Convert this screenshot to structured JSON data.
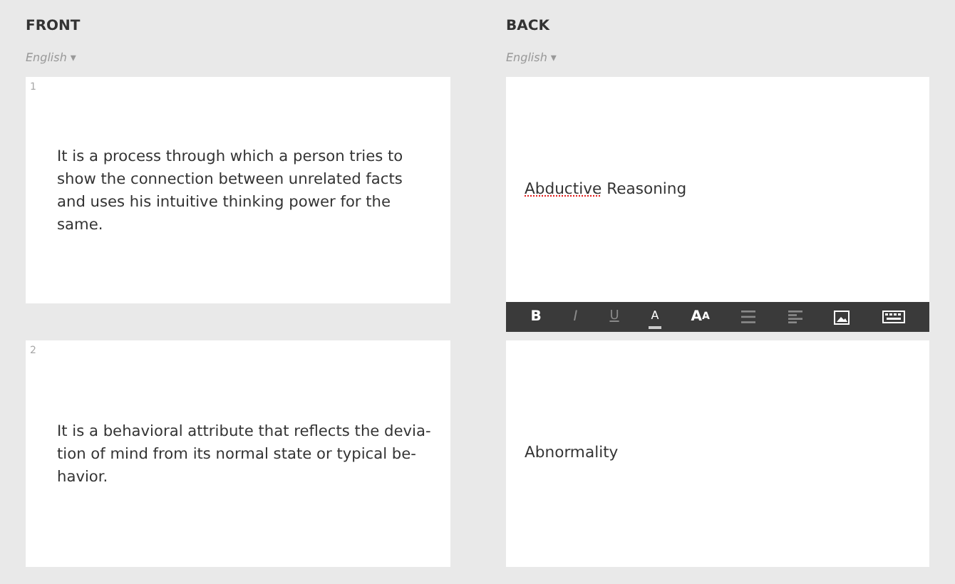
{
  "sides": [
    {
      "title": "FRONT",
      "language": "English ▾"
    },
    {
      "title": "BACK",
      "language": "English ▾"
    }
  ],
  "cards": [
    {
      "number": "1",
      "front_lines": [
        "It is a process through which a person tries to",
        "show the connection between unrelated facts",
        "and uses his intuitive thinking power for the",
        "same."
      ],
      "back": [
        {
          "text": "Abductive",
          "misspelled": true
        },
        {
          "text": " Reasoning",
          "misspelled": false
        }
      ],
      "editing": true
    },
    {
      "number": "2",
      "front_lines": [
        "It is a behavioral attribute that reflects the devia-",
        "tion of mind from its normal state or typical be-",
        "havior."
      ],
      "back": [
        {
          "text": "Abnormality",
          "misspelled": false
        }
      ],
      "editing": false
    }
  ],
  "toolbar": [
    {
      "kind": "bold",
      "label": "B",
      "enabled": true
    },
    {
      "kind": "italic",
      "label": "I",
      "enabled": false
    },
    {
      "kind": "underline",
      "label": "U",
      "enabled": false
    },
    {
      "kind": "color",
      "label": "A",
      "enabled": true
    },
    {
      "kind": "size",
      "label": "A",
      "small_label": "A",
      "enabled": true
    },
    {
      "kind": "list",
      "enabled": false
    },
    {
      "kind": "align",
      "enabled": false
    },
    {
      "kind": "image",
      "enabled": true
    },
    {
      "kind": "keyboard",
      "enabled": true
    }
  ]
}
